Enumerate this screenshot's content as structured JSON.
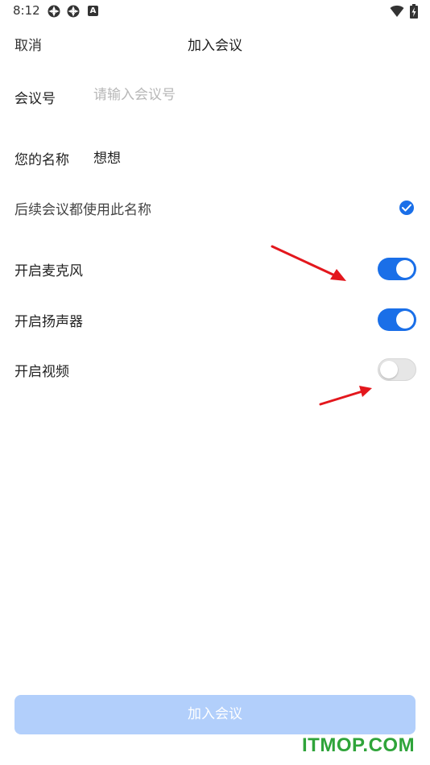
{
  "status_bar": {
    "time": "8:12",
    "icons": [
      "fan-icon",
      "fan-icon",
      "a-box-icon",
      "wifi-icon",
      "battery-icon"
    ],
    "a_box_glyph": "A"
  },
  "header": {
    "cancel_label": "取消",
    "title": "加入会议"
  },
  "meeting_id": {
    "label": "会议号",
    "value": "",
    "placeholder": "请输入会议号"
  },
  "display_name": {
    "label": "您的名称",
    "value": "想想"
  },
  "remember_name": {
    "label": "后续会议都使用此名称",
    "checked": true
  },
  "toggles": [
    {
      "label": "开启麦克风",
      "on": true
    },
    {
      "label": "开启扬声器",
      "on": true
    },
    {
      "label": "开启视频",
      "on": false
    }
  ],
  "join_button_label": "加入会议",
  "watermark": "ITMOP.COM",
  "colors": {
    "accent": "#1a6fe8",
    "join_button_disabled": "#b2cffb",
    "annotation_arrow": "#e3171d",
    "watermark": "#2fa43a"
  }
}
